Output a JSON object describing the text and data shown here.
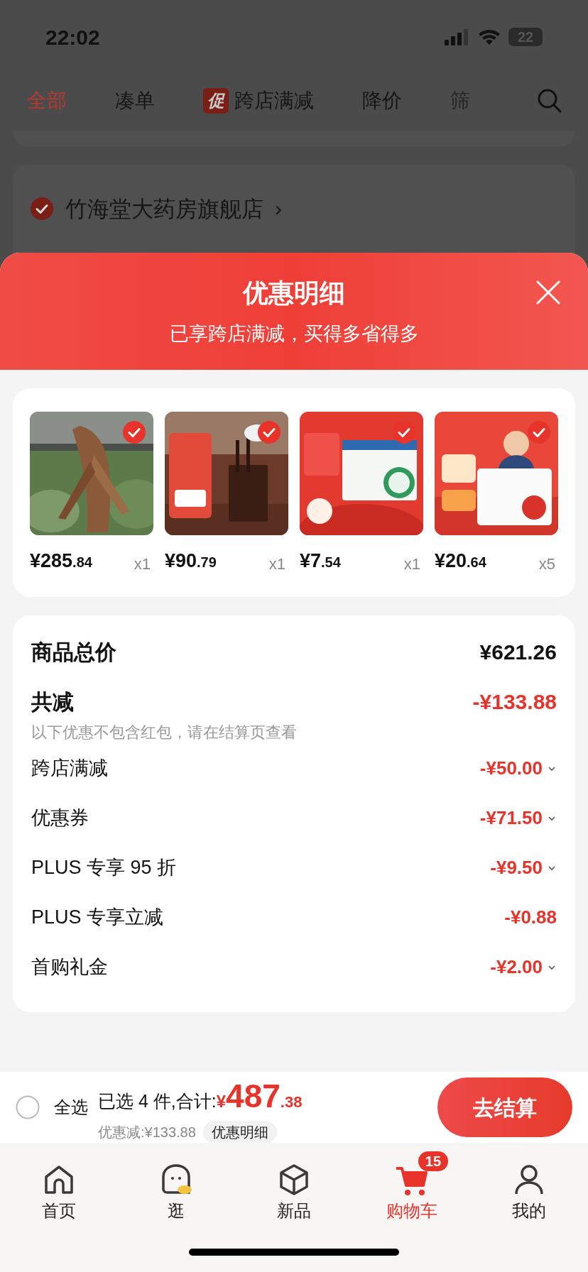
{
  "status_bar": {
    "time": "22:02",
    "battery": "22"
  },
  "tabs": [
    {
      "label": "全部",
      "selected": true
    },
    {
      "label": "凑单",
      "selected": false
    },
    {
      "label": "跨店满减",
      "selected": false,
      "badge": "促"
    },
    {
      "label": "降价",
      "selected": false
    },
    {
      "label": "筛",
      "selected": false
    }
  ],
  "store": {
    "name": "竹海堂大药房旗舰店",
    "checked": true,
    "chevron": "›"
  },
  "sheet": {
    "title": "优惠明细",
    "subtitle": "已享跨店满减，买得多省得多",
    "products": [
      {
        "kind": "picture",
        "price": "¥285",
        "decimals": ".84",
        "qty": "x1",
        "checked": true
      },
      {
        "kind": "picture",
        "price": "¥90",
        "decimals": ".79",
        "qty": "x1",
        "checked": true
      },
      {
        "kind": "picture",
        "price": "¥7",
        "decimals": ".54",
        "qty": "x1",
        "checked": true
      },
      {
        "kind": "picture",
        "price": "¥20",
        "decimals": ".64",
        "qty": "x5",
        "checked": true
      }
    ],
    "total": {
      "label": "商品总价",
      "value": "¥621.26"
    },
    "reduction": {
      "label": "共减",
      "value": "-¥133.88",
      "note": "以下优惠不包含红包，请在结算页查看"
    },
    "discounts": [
      {
        "label": "跨店满减",
        "value": "-¥50.00",
        "expandable": true
      },
      {
        "label": "优惠券",
        "value": "-¥71.50",
        "expandable": true
      },
      {
        "label": "PLUS 专享 95 折",
        "value": "-¥9.50",
        "expandable": true
      },
      {
        "label": "PLUS 专享立减",
        "value": "-¥0.88",
        "expandable": false
      },
      {
        "label": "首购礼金",
        "value": "-¥2.00",
        "expandable": true
      }
    ]
  },
  "checkout_bar": {
    "select_all": {
      "label": "全选",
      "checked": false
    },
    "summary": "已选 4 件,合计:",
    "currency": "¥",
    "amount": "487",
    "decimals": ".38",
    "saved": "优惠减:¥133.88",
    "details_button": "优惠明细",
    "checkout_button": "去结算"
  },
  "nav": [
    {
      "label": "首页",
      "selected": false
    },
    {
      "label": "逛",
      "selected": false
    },
    {
      "label": "新品",
      "selected": false
    },
    {
      "label": "购物车",
      "selected": true,
      "badge": "15"
    },
    {
      "label": "我的",
      "selected": false
    }
  ]
}
